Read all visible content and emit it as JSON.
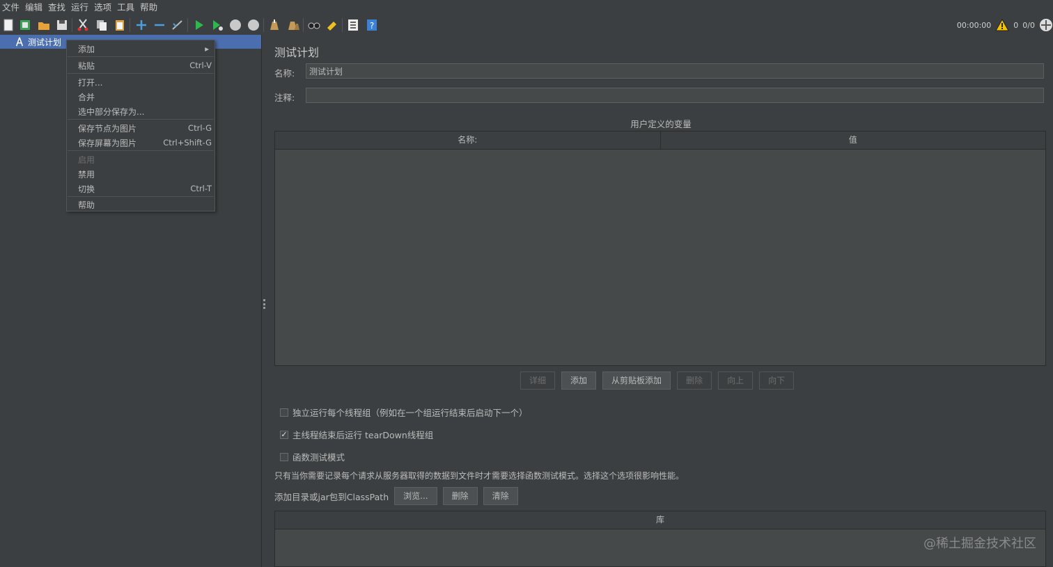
{
  "menubar": [
    "文件",
    "编辑",
    "查找",
    "运行",
    "选项",
    "工具",
    "帮助"
  ],
  "toolbar": {
    "icons": [
      "new-icon",
      "templates-icon",
      "open-icon",
      "save-icon",
      "cut-icon",
      "copy-icon",
      "paste-icon",
      "expand-icon",
      "collapse-icon",
      "toggle-icon",
      "start-icon",
      "start-no-pause-icon",
      "stop-icon",
      "shutdown-icon",
      "clear-icon",
      "clear-all-icon",
      "search-icon",
      "reset-search-icon",
      "function-helper-icon",
      "help-icon"
    ]
  },
  "status": {
    "timer": "00:00:00",
    "warnings": "0",
    "threads": "0/0"
  },
  "tree": {
    "root_label": "测试计划"
  },
  "context_menu": {
    "items": [
      {
        "label": "添加",
        "shortcut": "",
        "submenu": true,
        "disabled": false
      },
      {
        "label": "粘贴",
        "shortcut": "Ctrl-V",
        "disabled": false
      },
      {
        "label": "打开...",
        "shortcut": "",
        "disabled": false
      },
      {
        "label": "合并",
        "shortcut": "",
        "disabled": false
      },
      {
        "label": "选中部分保存为...",
        "shortcut": "",
        "disabled": false
      },
      {
        "label": "保存节点为图片",
        "shortcut": "Ctrl-G",
        "disabled": false
      },
      {
        "label": "保存屏幕为图片",
        "shortcut": "Ctrl+Shift-G",
        "disabled": false
      },
      {
        "label": "启用",
        "shortcut": "",
        "disabled": true
      },
      {
        "label": "禁用",
        "shortcut": "",
        "disabled": false
      },
      {
        "label": "切换",
        "shortcut": "Ctrl-T",
        "disabled": false
      },
      {
        "label": "帮助",
        "shortcut": "",
        "disabled": false
      }
    ]
  },
  "panel": {
    "title": "测试计划",
    "name_label": "名称:",
    "name_value": "测试计划",
    "comment_label": "注释:",
    "comment_value": "",
    "variables_title": "用户定义的变量",
    "columns": [
      "名称:",
      "值"
    ],
    "buttons": [
      {
        "label": "详细",
        "disabled": true
      },
      {
        "label": "添加",
        "disabled": false
      },
      {
        "label": "从剪贴板添加",
        "disabled": false
      },
      {
        "label": "删除",
        "disabled": true
      },
      {
        "label": "向上",
        "disabled": true
      },
      {
        "label": "向下",
        "disabled": true
      }
    ],
    "checkboxes": [
      {
        "label": "独立运行每个线程组（例如在一个组运行结束后启动下一个）",
        "checked": false
      },
      {
        "label": "主线程结束后运行 tearDown线程组",
        "checked": true
      },
      {
        "label": "函数测试模式",
        "checked": false
      }
    ],
    "functional_note": "只有当你需要记录每个请求从服务器取得的数据到文件时才需要选择函数测试模式。选择这个选项很影响性能。",
    "classpath_label": "添加目录或jar包到ClassPath",
    "classpath_buttons": [
      "浏览...",
      "删除",
      "清除"
    ],
    "library_header": "库"
  },
  "watermark": "@稀土掘金技术社区"
}
